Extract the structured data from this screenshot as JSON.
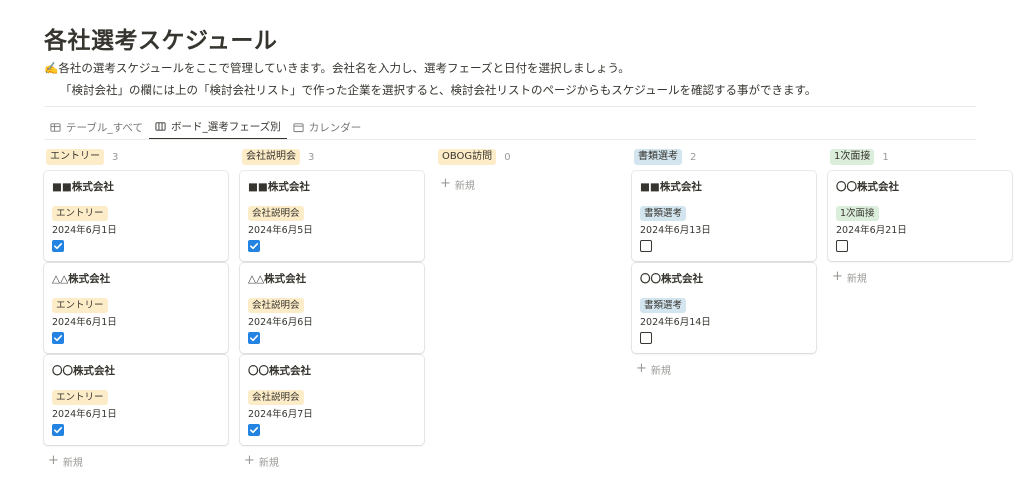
{
  "page": {
    "title": "各社選考スケジュール",
    "description_line1": "✍️各社の選考スケジュールをここで管理していきます。会社名を入力し、選考フェーズと日付を選択しましょう。",
    "description_line2": "「検討会社」の欄には上の「検討会社リスト」で作った企業を選択すると、検討会社リストのページからもスケジュールを確認する事ができます。"
  },
  "tabs": [
    {
      "label": "テーブル_すべて",
      "icon": "table-icon",
      "active": false
    },
    {
      "label": "ボード_選考フェーズ別",
      "icon": "board-icon",
      "active": true
    },
    {
      "label": "カレンダー",
      "icon": "calendar-icon",
      "active": false
    }
  ],
  "new_label": "新規",
  "columns": [
    {
      "name": "エントリー",
      "count": "3",
      "color": "#fdecc8",
      "cards": [
        {
          "company": "■■株式会社",
          "tag": "エントリー",
          "date": "2024年6月1日",
          "checked": true
        },
        {
          "company": "△△株式会社",
          "tag": "エントリー",
          "date": "2024年6月1日",
          "checked": true
        },
        {
          "company": "〇〇株式会社",
          "tag": "エントリー",
          "date": "2024年6月1日",
          "checked": true
        }
      ]
    },
    {
      "name": "会社説明会",
      "count": "3",
      "color": "#fdecc8",
      "cards": [
        {
          "company": "■■株式会社",
          "tag": "会社説明会",
          "date": "2024年6月5日",
          "checked": true
        },
        {
          "company": "△△株式会社",
          "tag": "会社説明会",
          "date": "2024年6月6日",
          "checked": true
        },
        {
          "company": "〇〇株式会社",
          "tag": "会社説明会",
          "date": "2024年6月7日",
          "checked": true
        }
      ]
    },
    {
      "name": "OBOG訪問",
      "count": "0",
      "color": "#fdecc8",
      "cards": []
    },
    {
      "name": "書類選考",
      "count": "2",
      "color": "#d3e5ef",
      "cards": [
        {
          "company": "■■株式会社",
          "tag": "書類選考",
          "date": "2024年6月13日",
          "checked": false
        },
        {
          "company": "〇〇株式会社",
          "tag": "書類選考",
          "date": "2024年6月14日",
          "checked": false
        }
      ]
    },
    {
      "name": "1次面接",
      "count": "1",
      "color": "#dbeddb",
      "cards": [
        {
          "company": "〇〇株式会社",
          "tag": "1次面接",
          "date": "2024年6月21日",
          "checked": false
        }
      ]
    }
  ]
}
